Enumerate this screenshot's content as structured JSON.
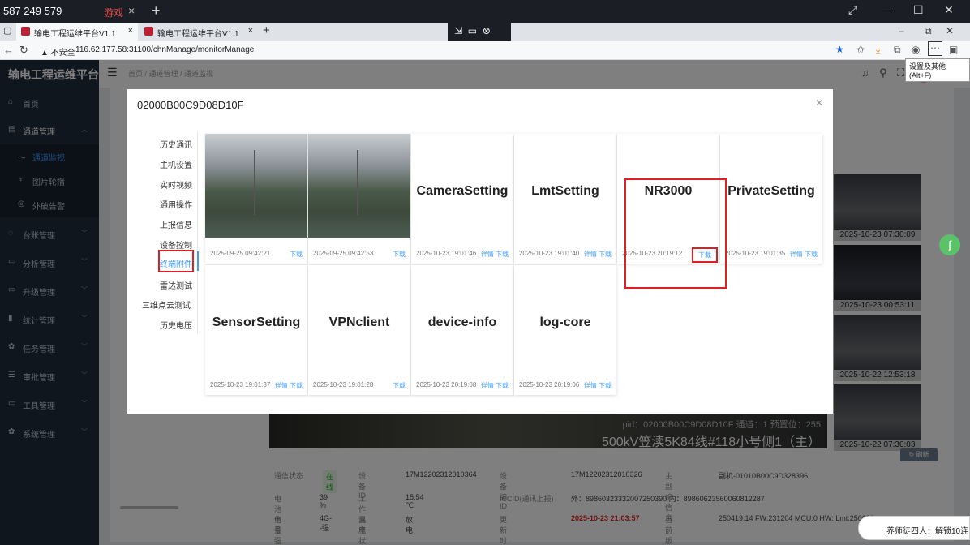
{
  "system_bar": {
    "signal": "587 249 579",
    "game_label": "游戏"
  },
  "tabs": [
    {
      "label": "输电工程运维平台V1.1"
    },
    {
      "label": "输电工程运维平台V1.1"
    }
  ],
  "address": {
    "security": "不安全",
    "url": "116.62.177.58:31100/chnManage/monitorManage",
    "tooltip": "设置及其他 (Alt+F)"
  },
  "sidebar": {
    "logo": "输电工程运维平台",
    "items": [
      {
        "label": "首页",
        "icon": "home-icon"
      },
      {
        "label": "通道管理",
        "icon": "folder-icon"
      },
      {
        "label": "通道监视",
        "icon": "monitor-icon"
      },
      {
        "label": "图片轮播",
        "icon": "carousel-icon"
      },
      {
        "label": "外破告警",
        "icon": "alarm-icon"
      },
      {
        "label": "台账管理",
        "icon": "ledger-icon"
      },
      {
        "label": "分析管理",
        "icon": "analysis-icon"
      },
      {
        "label": "升级管理",
        "icon": "upgrade-icon"
      },
      {
        "label": "统计管理",
        "icon": "stats-icon"
      },
      {
        "label": "任务管理",
        "icon": "task-icon"
      },
      {
        "label": "审批管理",
        "icon": "approve-icon"
      },
      {
        "label": "工具管理",
        "icon": "tool-icon"
      },
      {
        "label": "系统管理",
        "icon": "system-icon"
      }
    ]
  },
  "header": {
    "breadcrumb": "首页 / 通道管理 / 通道监视",
    "tab_home": "首页"
  },
  "modal": {
    "title": "02000B00C9D08D10F",
    "nav": [
      "历史通讯",
      "主机设置",
      "实时视频",
      "通用操作",
      "上报信息",
      "设备控制",
      "终端附件",
      "雷达测试",
      "三维点云测试",
      "历史电压"
    ],
    "cards": [
      {
        "name": "",
        "date": "2025-09-25 09:42:21",
        "actions": "下载",
        "image": true
      },
      {
        "name": "",
        "date": "2025-09-25 09:42:53",
        "actions": "下载",
        "image": true
      },
      {
        "name": "CameraSetting",
        "date": "2025-10-23 19:01:46",
        "actions": "详情 下载"
      },
      {
        "name": "LmtSetting",
        "date": "2025-10-23 19:01:40",
        "actions": "详情 下载"
      },
      {
        "name": "NR3000",
        "date": "2025-10-23 20:19:12",
        "actions": "下载"
      },
      {
        "name": "PrivateSetting",
        "date": "2025-10-23 19:01:35",
        "actions": "详情 下载"
      },
      {
        "name": "SensorSetting",
        "date": "2025-10-23 19:01:37",
        "actions": "详情 下载"
      },
      {
        "name": "VPNclient",
        "date": "2025-10-23 19:01:28",
        "actions": "下载"
      },
      {
        "name": "device-info",
        "date": "2025-10-23 20:19:08",
        "actions": "详情 下载"
      },
      {
        "name": "log-core",
        "date": "2025-10-23 20:19:06",
        "actions": "详情 下载"
      }
    ]
  },
  "thumbnails": [
    "2025-10-23 07:30:09",
    "2025-10-23 00:53:11",
    "2025-10-22 12:53:18",
    "2025-10-22 07:30:03"
  ],
  "video_overlay": {
    "line1": "pid：02000B00C9D08D10F 通道：1 预置位：255",
    "line2": "500kV笠渎5K84线#118小号侧1（主）"
  },
  "refresh_label": "刷新",
  "info": [
    [
      {
        "k": "通信状态",
        "v": "在线",
        "style": "green"
      },
      {
        "k": "设备ID",
        "v": "17M12202312010364"
      },
      {
        "k": "设备编ID",
        "v": "17M12202312010326"
      },
      {
        "k": "主副机信息",
        "v": "副机-01010B00C9D328396"
      }
    ],
    [
      {
        "k": "电池电量",
        "v": "39 %"
      },
      {
        "k": "工作温度",
        "v": "15.54 ℃"
      },
      {
        "k": "ICCID(通讯上报)",
        "v": "外：89860323332007250390 内：89860623560060812287"
      }
    ],
    [
      {
        "k": "信号强度",
        "v": "4G--强"
      },
      {
        "k": "充电状态",
        "v": "放电"
      },
      {
        "k": "更新时间",
        "v": "2025-10-23 21:03:57",
        "style": "red"
      },
      {
        "k": "当前版本",
        "v": "250419.14 FW:231204 MCU:0 HW: Lmt:250626"
      }
    ]
  ],
  "toast": "养师徒四人：解锁10连"
}
